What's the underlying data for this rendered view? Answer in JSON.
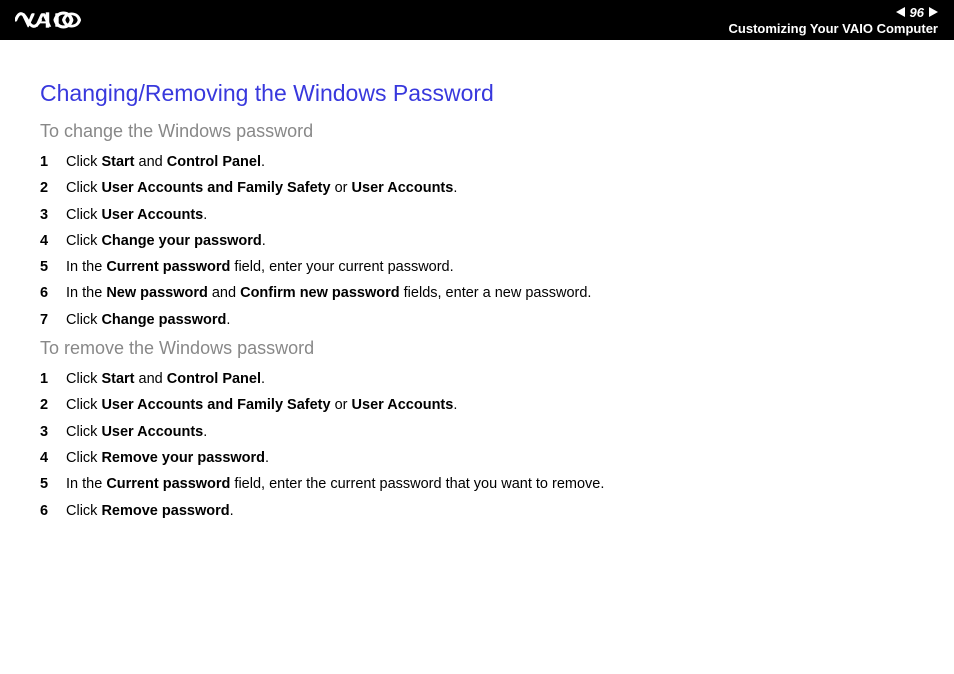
{
  "header": {
    "page_number": "96",
    "title": "Customizing Your VAIO Computer"
  },
  "content": {
    "title": "Changing/Removing the Windows Password",
    "section1": {
      "subtitle": "To change the Windows password",
      "steps": [
        {
          "n": "1",
          "html": "Click <b>Start</b> and <b>Control Panel</b>."
        },
        {
          "n": "2",
          "html": "Click <b>User Accounts and Family Safety</b> or <b>User Accounts</b>."
        },
        {
          "n": "3",
          "html": "Click <b>User Accounts</b>."
        },
        {
          "n": "4",
          "html": "Click <b>Change your password</b>."
        },
        {
          "n": "5",
          "html": "In the <b>Current password</b> field, enter your current password."
        },
        {
          "n": "6",
          "html": "In the <b>New password</b> and <b>Confirm new password</b> fields, enter a new password."
        },
        {
          "n": "7",
          "html": "Click <b>Change password</b>."
        }
      ]
    },
    "section2": {
      "subtitle": "To remove the Windows password",
      "steps": [
        {
          "n": "1",
          "html": "Click <b>Start</b> and <b>Control Panel</b>."
        },
        {
          "n": "2",
          "html": "Click <b>User Accounts and Family Safety</b> or <b>User Accounts</b>."
        },
        {
          "n": "3",
          "html": "Click <b>User Accounts</b>."
        },
        {
          "n": "4",
          "html": "Click <b>Remove your password</b>."
        },
        {
          "n": "5",
          "html": "In the <b>Current password</b> field, enter the current password that you want to remove."
        },
        {
          "n": "6",
          "html": "Click <b>Remove password</b>."
        }
      ]
    }
  }
}
